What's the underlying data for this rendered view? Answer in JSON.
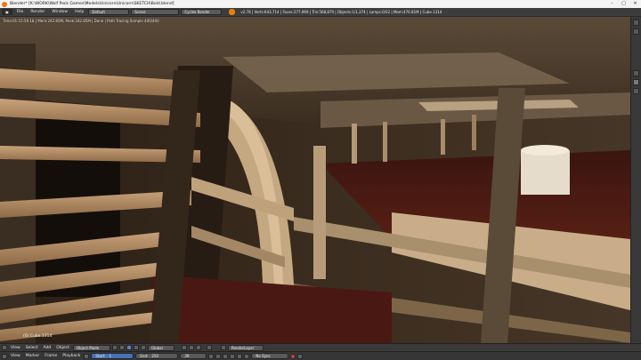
{
  "window": {
    "title": "Blender* [K:\\WORK\\Wolf Pack Games\\Models\\Unicorn\\Unicorn\\SKETCH\\Bold.blend]",
    "controls": [
      "–",
      "▢",
      "✕"
    ]
  },
  "menubar": {
    "menus": [
      "File",
      "Render",
      "Window",
      "Help"
    ],
    "layout": "Default",
    "scene": "Scene",
    "engine": "Cycles Render",
    "stats": "v2.78 | Verts:643,714 | Faces:277,969 | Tris:568,879 | Objects:1/1,374 | Lamps:0/22 | Mem:476.81M | Cube.1314"
  },
  "viewport": {
    "render_info": "Time:01:15:59.18 | Mem:242.85M, Peak:242.85M | Done | Path Tracing Sample 400/400",
    "object_name": "(0) Cube.1314"
  },
  "header3d": {
    "menus": [
      "View",
      "Select",
      "Add",
      "Object"
    ],
    "mode": "Object Mode",
    "orientation": "Global",
    "render_layer": "RenderLayer"
  },
  "timeline": {
    "menus": [
      "View",
      "Marker",
      "Frame",
      "Playback"
    ],
    "start_label": "Start:",
    "start": "1",
    "end_label": "End:",
    "end": "250",
    "current": "39",
    "sync": "No Sync"
  },
  "icons": {
    "app": "blender-icon",
    "record": "record-icon"
  },
  "colors": {
    "accent": "#e87d0d",
    "header": "#3d3d3d",
    "selection": "#4772b3"
  }
}
